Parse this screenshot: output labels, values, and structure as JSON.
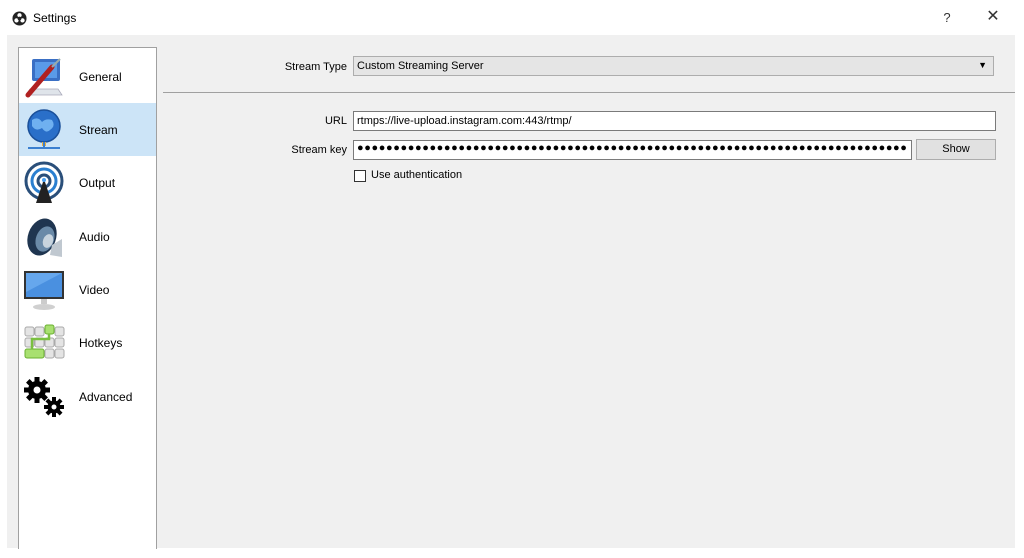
{
  "window": {
    "title": "Settings",
    "help_label": "?",
    "close_label": "✕"
  },
  "sidebar": {
    "items": [
      {
        "label": "General",
        "icon": "general-icon",
        "active": false
      },
      {
        "label": "Stream",
        "icon": "stream-globe-icon",
        "active": true
      },
      {
        "label": "Output",
        "icon": "output-broadcast-icon",
        "active": false
      },
      {
        "label": "Audio",
        "icon": "speaker-icon",
        "active": false
      },
      {
        "label": "Video",
        "icon": "monitor-icon",
        "active": false
      },
      {
        "label": "Hotkeys",
        "icon": "keyboard-icon",
        "active": false
      },
      {
        "label": "Advanced",
        "icon": "gears-icon",
        "active": false
      }
    ]
  },
  "stream": {
    "stream_type_label": "Stream Type",
    "stream_type_value": "Custom Streaming Server",
    "url_label": "URL",
    "url_value": "rtmps://live-upload.instagram.com:443/rtmp/",
    "stream_key_label": "Stream key",
    "stream_key_masked": "●●●●●●●●●●●●●●●●●●●●●●●●●●●●●●●●●●●●●●●●●●●●●●●●●●●●●●●●●●●●●●●●●●●●●●●●●●●●●●●●●●",
    "show_button": "Show",
    "use_auth_label": "Use authentication",
    "use_auth_checked": false
  },
  "colors": {
    "active_item_bg": "#cce4f7",
    "panel_bg": "#f0f0f0"
  }
}
